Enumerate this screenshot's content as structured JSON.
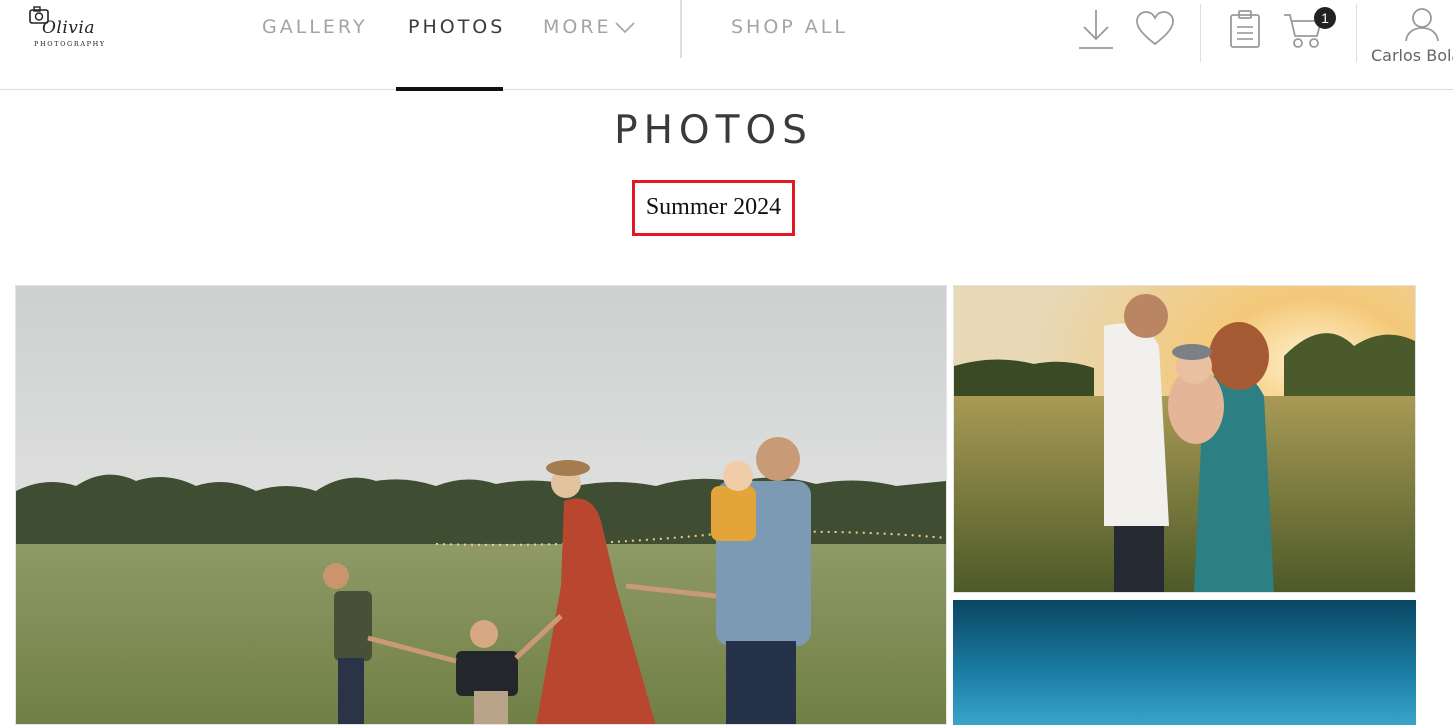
{
  "brand": {
    "logo_script": "Olivia",
    "logo_subtitle": "PHOTOGRAPHY"
  },
  "nav": {
    "gallery": "GALLERY",
    "photos": "PHOTOS",
    "more": "MORE",
    "shop_all": "SHOP ALL",
    "active": "PHOTOS"
  },
  "header_icons": {
    "download": "download-icon",
    "favorites": "heart-icon",
    "orders": "clipboard-icon",
    "cart": "cart-icon",
    "cart_count": "1",
    "account": "user-icon",
    "user_name": "Carlos Bola"
  },
  "page": {
    "title": "PHOTOS",
    "album_name": "Summer 2024",
    "album_highlight_color": "#e11a22"
  },
  "photos": [
    {
      "name": "family-walking-field-photo"
    },
    {
      "name": "couple-holding-baby-sunset-photo"
    },
    {
      "name": "blue-sky-photo"
    }
  ]
}
